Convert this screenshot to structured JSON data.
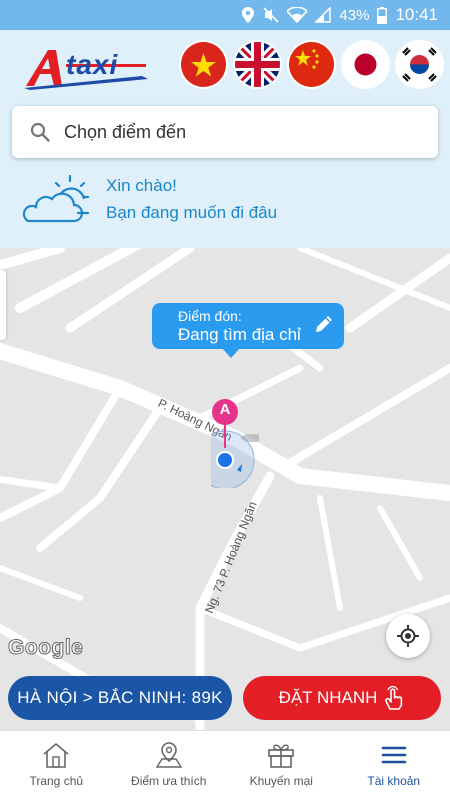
{
  "status_bar": {
    "battery": "43%",
    "time": "10:41",
    "icons": [
      "location-icon",
      "mute-icon",
      "wifi-icon",
      "signal-icon",
      "battery-icon"
    ]
  },
  "header": {
    "logo_text": "taxi",
    "languages": [
      {
        "name": "vietnam-flag-icon"
      },
      {
        "name": "uk-flag-icon"
      },
      {
        "name": "china-flag-icon"
      },
      {
        "name": "japan-flag-icon"
      },
      {
        "name": "korea-flag-icon"
      }
    ]
  },
  "search": {
    "placeholder": "Chọn điểm đến"
  },
  "greeting": {
    "line1": "Xin chào!",
    "line2": "Bạn đang muốn đi đâu"
  },
  "map": {
    "bubble_label": "Điểm đón:",
    "bubble_address": "Đang tìm địa chỉ",
    "pin_label": "A",
    "road_labels": [
      "P. Hoàng Ngân",
      "Ng. 73 P. Hoàng Ngân"
    ],
    "attribution": "Google"
  },
  "actions": {
    "route_label": "HÀ NỘI > BẮC NINH: 89K",
    "quick_book_label": "ĐẶT NHANH"
  },
  "nav": [
    {
      "label": "Trang chủ",
      "icon": "home-icon",
      "active": false
    },
    {
      "label": "Điểm ưa thích",
      "icon": "favorite-place-icon",
      "active": false
    },
    {
      "label": "Khuyến mại",
      "icon": "gift-icon",
      "active": false
    },
    {
      "label": "Tài khoản",
      "icon": "menu-icon",
      "active": true
    }
  ],
  "colors": {
    "status_bar": "#72b8ec",
    "header_bg": "#dff0fb",
    "brand_blue": "#1a55a6",
    "accent_red": "#e31e25",
    "bubble_blue": "#2b9bf0",
    "greeting_text": "#1d87c8"
  }
}
